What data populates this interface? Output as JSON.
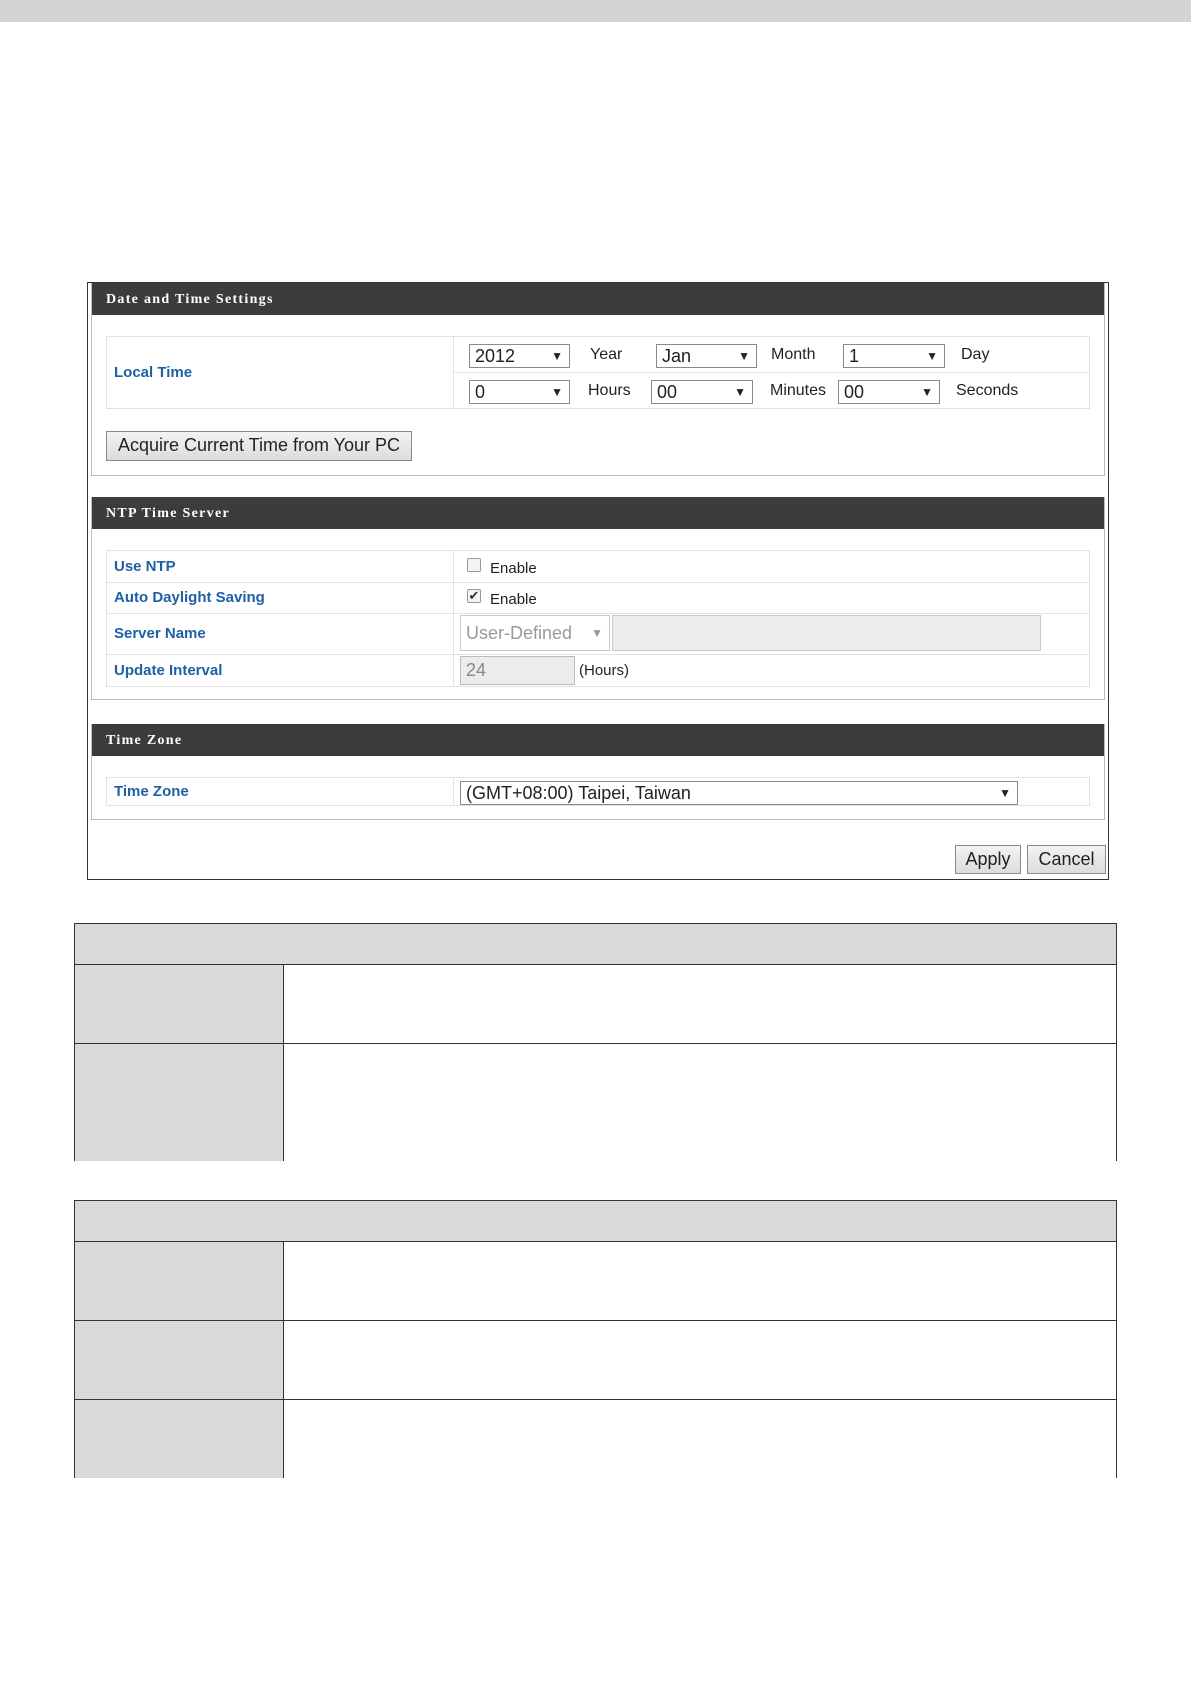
{
  "date_time_settings": {
    "title": "Date and Time Settings",
    "local_time_label": "Local Time",
    "year_value": "2012",
    "year_unit": "Year",
    "month_value": "Jan",
    "month_unit": "Month",
    "day_value": "1",
    "day_unit": "Day",
    "hours_value": "0",
    "hours_unit": "Hours",
    "minutes_value": "00",
    "minutes_unit": "Minutes",
    "seconds_value": "00",
    "seconds_unit": "Seconds",
    "acquire_button": "Acquire Current Time from Your PC"
  },
  "ntp": {
    "title": "NTP Time Server",
    "use_ntp_label": "Use NTP",
    "use_ntp_checked": false,
    "use_ntp_option": "Enable",
    "auto_dst_label": "Auto Daylight Saving",
    "auto_dst_checked": true,
    "auto_dst_option": "Enable",
    "server_name_label": "Server Name",
    "server_name_select": "User-Defined",
    "server_name_value": "",
    "update_interval_label": "Update Interval",
    "update_interval_value": "24",
    "update_interval_unit": "(Hours)"
  },
  "time_zone": {
    "title": "Time Zone",
    "label": "Time Zone",
    "value": "(GMT+08:00) Taipei, Taiwan"
  },
  "actions": {
    "apply": "Apply",
    "cancel": "Cancel"
  },
  "icons": {
    "dropdown": "chevron-down-icon",
    "checkbox": "checkbox-icon"
  }
}
